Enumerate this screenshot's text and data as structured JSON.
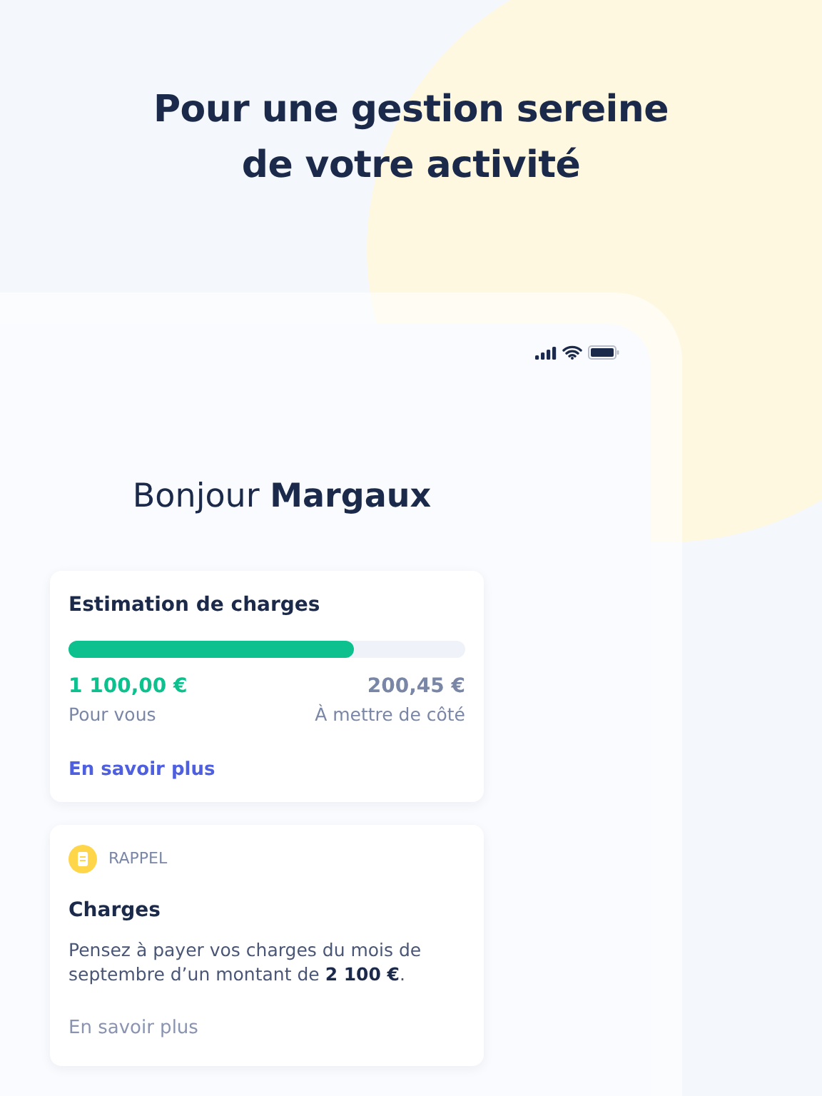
{
  "headline": [
    "Pour une gestion sereine",
    "de votre activité"
  ],
  "greeting": "Bonjour **Margaux**",
  "estimation": {
    "title": "Estimation de charges",
    "level": 0.72,
    "left_amount": "1 100,00 €",
    "left_label": "Pour vous",
    "right_amount": "200,45 €",
    "right_label": "À mettre de côté",
    "link": "En savoir plus"
  },
  "reminder": {
    "tag": "RAPPEL",
    "title": "Charges",
    "text": "Pensez à payer vos charges du mois de septembre d’un montant de **2 100 €**.",
    "link": "En savoir plus"
  }
}
